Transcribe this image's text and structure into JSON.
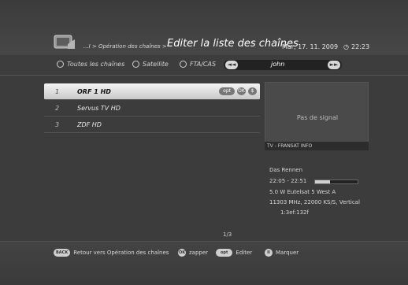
{
  "header": {
    "breadcrumb": "...I > Opération des chaînes >",
    "title": "Editer la liste des chaînes",
    "date": "Mar, 17. 11. 2009",
    "time": "22:23"
  },
  "filters": {
    "options": [
      "Toutes les chaînes",
      "Satellite",
      "FTA/CAS"
    ],
    "list_name": "john",
    "prev_glyph": "◄◄",
    "next_glyph": "►►"
  },
  "channels": [
    {
      "num": "1",
      "name": "ORF 1 HD",
      "selected": true
    },
    {
      "num": "2",
      "name": "Servus TV HD",
      "selected": false
    },
    {
      "num": "3",
      "name": "ZDF HD",
      "selected": false
    }
  ],
  "row_buttons": {
    "opt": "opt",
    "ok": "OK",
    "s": "$"
  },
  "preview": {
    "no_signal": "Pas de signal",
    "caption": "TV - FRANSAT INFO"
  },
  "info": {
    "program": "Das Rennen",
    "time_range": "22:05 - 22:51",
    "progress_fraction": 0.35,
    "satellite": "5.0 W Eutelsat 5 West A",
    "transponder": "11303 MHz, 22000 KS/S, Vertical",
    "ids": "1:3ef:132f"
  },
  "page_indicator": "1/3",
  "footer": {
    "back_key": "BACK",
    "back_label": "Retour vers Opération des chaînes",
    "ok_key": "OK",
    "ok_label": "zapper",
    "opt_key": "opt",
    "opt_label": "Editer",
    "mark_key": "II",
    "mark_label": "Marquer"
  }
}
